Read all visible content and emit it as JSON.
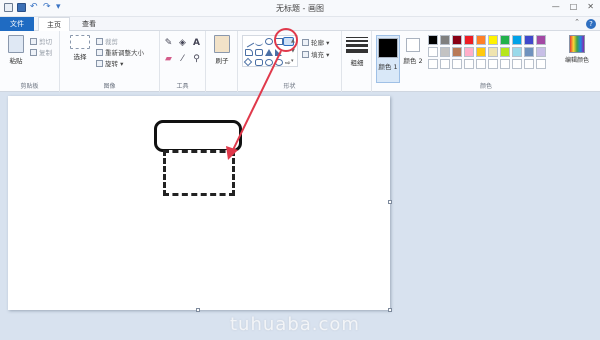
{
  "window": {
    "title": "无标题 - 画图",
    "controls": [
      "—",
      "□",
      "✕"
    ]
  },
  "tabs": {
    "file": "文件",
    "home": "主页",
    "view": "查看"
  },
  "ribbon": {
    "clipboard": {
      "paste": "粘贴",
      "cut": "剪切",
      "copy": "复制",
      "label": "剪贴板"
    },
    "image": {
      "select": "选择",
      "crop": "裁剪",
      "resize": "重新调整大小",
      "rotate": "旋转 ▾",
      "label": "图像"
    },
    "tools": {
      "label": "工具"
    },
    "brushes": {
      "label": "刷子"
    },
    "shapes": {
      "outline": "轮廓 ▾",
      "fill": "填充 ▾",
      "label": "形状"
    },
    "size": {
      "label": "粗细"
    },
    "colors": {
      "color1": "颜色 1",
      "color2": "颜色 2",
      "edit": "编辑颜色",
      "label": "颜色",
      "color1_value": "#000000",
      "color2_value": "#ffffff",
      "palette": [
        "#000000",
        "#7f7f7f",
        "#880015",
        "#ed1c24",
        "#ff7f27",
        "#fff200",
        "#22b14c",
        "#00a2e8",
        "#3f48cc",
        "#a349a4",
        "#ffffff",
        "#c3c3c3",
        "#b97a57",
        "#ffaec9",
        "#ffc90e",
        "#efe4b0",
        "#b5e61d",
        "#99d9ea",
        "#7092be",
        "#c8bfe7",
        "#ffffff",
        "#ffffff",
        "#ffffff",
        "#ffffff",
        "#ffffff",
        "#ffffff",
        "#ffffff",
        "#ffffff",
        "#ffffff",
        "#ffffff"
      ]
    }
  },
  "watermark": "tuhuaba.com",
  "accent": "#e0394b"
}
